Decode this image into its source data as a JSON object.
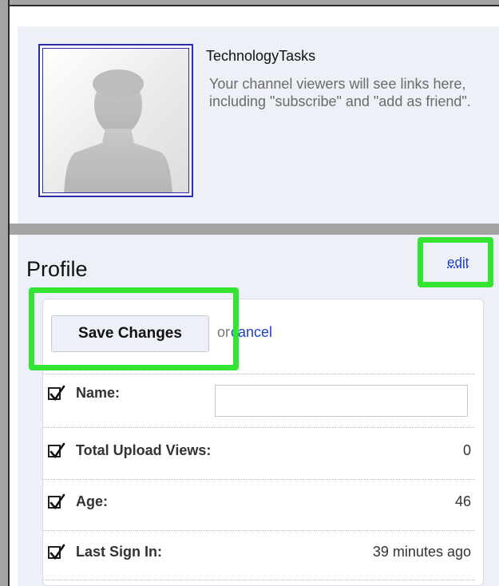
{
  "channel": {
    "name": "TechnologyTasks",
    "description": "Your channel viewers will see links here, including \"subscribe\" and \"add as friend\"."
  },
  "profile": {
    "title": "Profile",
    "edit_label": "edit",
    "save_label": "Save Changes",
    "or_text": "or",
    "cancel_label": "cancel",
    "fields": [
      {
        "label": "Name:",
        "value": "",
        "checked": true,
        "input": true
      },
      {
        "label": "Total Upload Views:",
        "value": "0",
        "checked": true
      },
      {
        "label": "Age:",
        "value": "46",
        "checked": true
      },
      {
        "label": "Last Sign In:",
        "value": "39 minutes ago",
        "checked": true
      }
    ]
  },
  "colors": {
    "highlight": "#33e433",
    "link": "#1f3fbf",
    "panel_bg": "#eef0f8"
  },
  "icons": {
    "avatar": "default-user-silhouette",
    "checkbox": "checkmark-icon"
  }
}
